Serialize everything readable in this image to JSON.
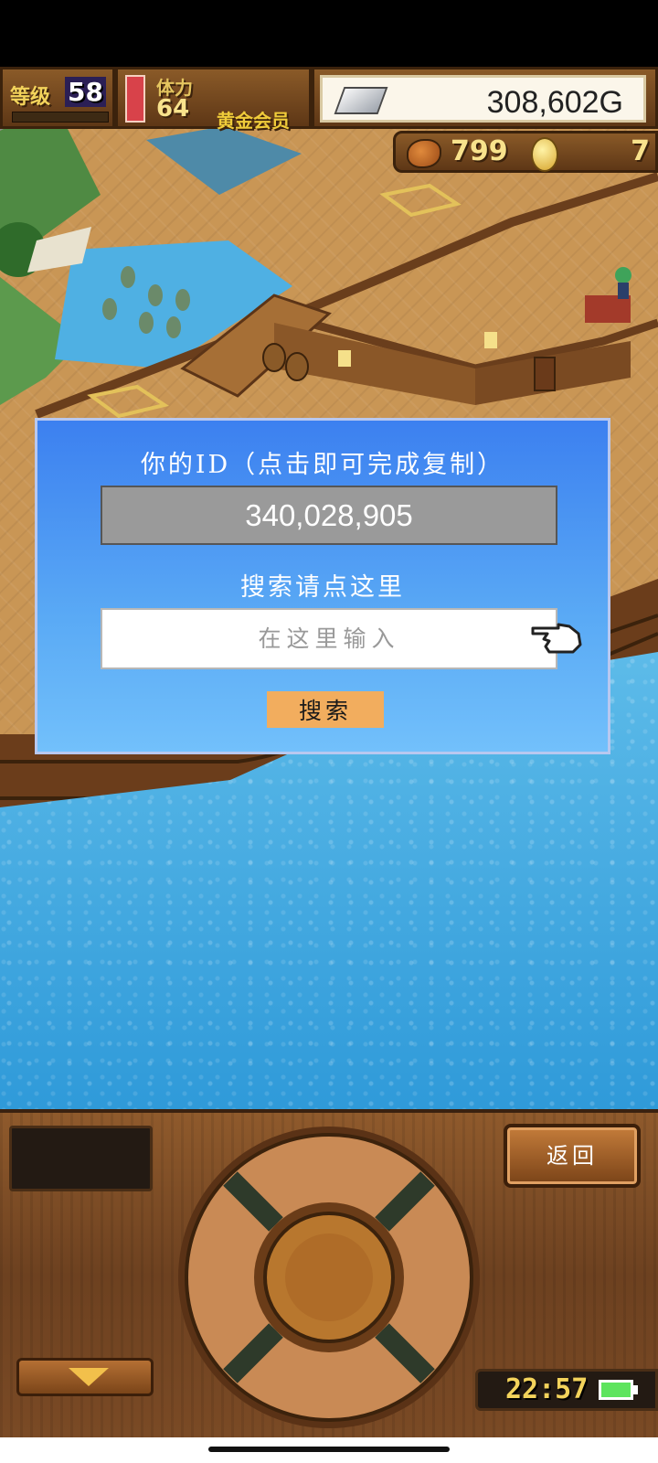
{
  "hud": {
    "level_label": "等级",
    "level": "58",
    "stamina_label": "体力",
    "stamina": "64",
    "membership": "黄金会员",
    "money": "308,602G",
    "food": "799",
    "medals": "7"
  },
  "dialog": {
    "id_label": "你的ID（点击即可完成复制）",
    "id_value": "340,028,905",
    "search_label": "搜索请点这里",
    "search_placeholder": "在这里输入",
    "search_button": "搜索"
  },
  "bottom": {
    "back_button": "返回",
    "clock": "22:57"
  },
  "colors": {
    "dialog_top": "#3c80f0",
    "dialog_bottom": "#72c0fb",
    "search_button": "#f2ad5e",
    "id_box": "#9a9a9a",
    "sea": "#3aa3de"
  },
  "icons": [
    "silver-ingot-icon",
    "food-icon",
    "medal-coin-icon",
    "pointing-hand-icon",
    "down-arrow-icon",
    "battery-icon"
  ]
}
